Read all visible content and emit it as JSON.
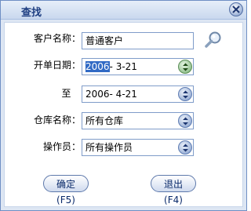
{
  "window": {
    "title": "查找"
  },
  "form": {
    "customer": {
      "label": "客户名称：",
      "value": "普通客户"
    },
    "order_date": {
      "label": "开单日期：",
      "value_selected": "2006",
      "value_rest": "- 3-21"
    },
    "to_date": {
      "label": "至",
      "value": "2006- 4-21"
    },
    "warehouse": {
      "label": "仓库名称：",
      "value": "所有仓库"
    },
    "operator": {
      "label": "操作员：",
      "value": "所有操作员"
    }
  },
  "buttons": {
    "confirm": "确定(F5)",
    "exit": "退出(F4)"
  },
  "colors": {
    "accent": "#316ac5",
    "title": "#1f3f82",
    "frame": "#6f8fc4"
  }
}
